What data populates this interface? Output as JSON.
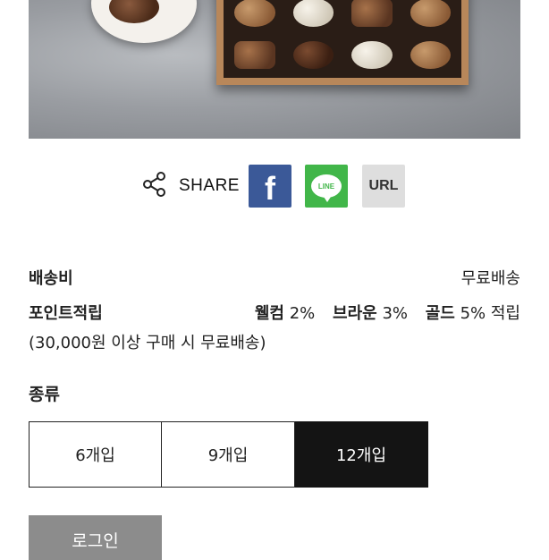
{
  "share": {
    "label": "SHARE",
    "icon": "share-icon",
    "buttons": [
      {
        "name": "facebook",
        "glyph": "f",
        "color": "#3b5998"
      },
      {
        "name": "line",
        "glyph": "LINE",
        "color": "#41b649"
      },
      {
        "name": "url",
        "glyph": "URL",
        "color": "#dedede"
      }
    ]
  },
  "shipping": {
    "label": "배송비",
    "value": "무료배송"
  },
  "points": {
    "label": "포인트적립",
    "tiers": [
      {
        "name": "웰컴",
        "rate": "2%"
      },
      {
        "name": "브라운",
        "rate": "3%"
      },
      {
        "name": "골드",
        "rate": "5% 적립"
      }
    ],
    "note": "(30,000원 이상 구매 시 무료배송)"
  },
  "type": {
    "label": "종류",
    "options": [
      "6개입",
      "9개입",
      "12개입"
    ],
    "selected": "12개입"
  },
  "login": {
    "label": "로그인"
  }
}
